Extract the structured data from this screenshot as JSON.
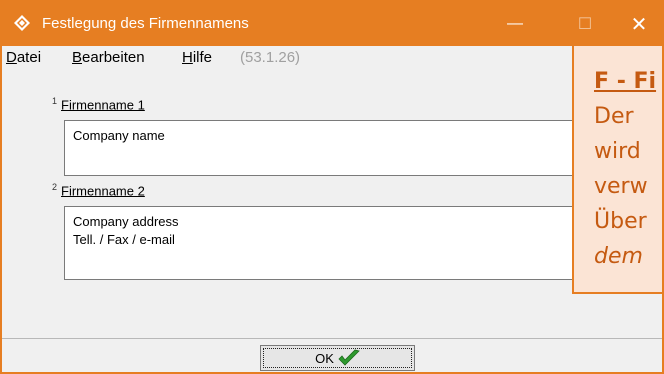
{
  "window": {
    "title": "Festlegung des Firmennamens",
    "accent_color": "#e67e22",
    "icon": "diamond-app-icon",
    "controls": {
      "minimize": "—",
      "maximize": "☐",
      "close": "✕"
    }
  },
  "menu": {
    "datei": {
      "acc": "D",
      "rest": "atei"
    },
    "bearbeiten": {
      "acc": "B",
      "rest": "earbeiten"
    },
    "hilfe": {
      "acc": "H",
      "rest": "ilfe"
    },
    "version": "(53.1.26)"
  },
  "fields": [
    {
      "index": "1",
      "label": "Firmenname 1",
      "value": "Company name"
    },
    {
      "index": "2",
      "label": "Firmenname 2",
      "value": "Company address\nTell. / Fax / e-mail"
    }
  ],
  "ok_button": {
    "label": "OK",
    "icon": "checkmark-icon"
  },
  "callout": {
    "title": "F - Fi",
    "lines": [
      "Der",
      "wird",
      "verw",
      "Über"
    ],
    "italic_line": "dem",
    "border_color": "#e67e22",
    "background_color": "#fbe4d5"
  }
}
